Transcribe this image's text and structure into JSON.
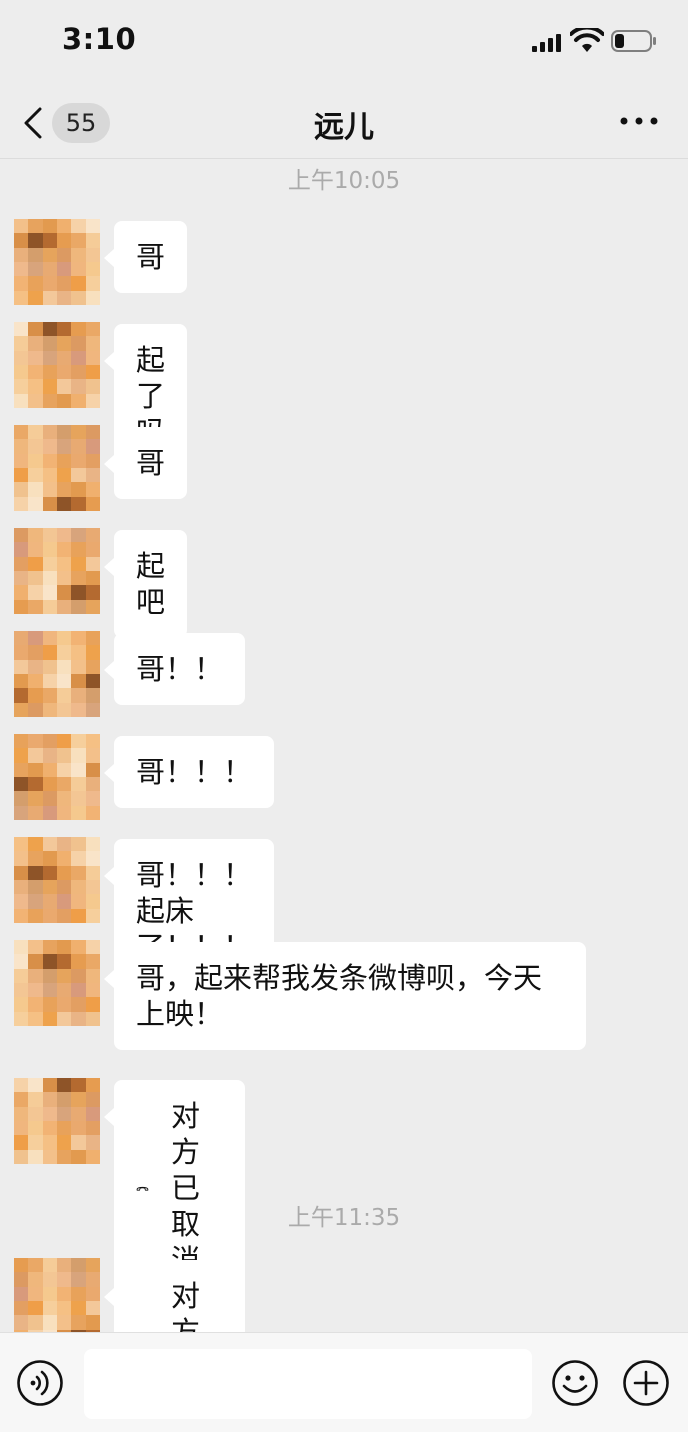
{
  "status_bar": {
    "time": "3:10"
  },
  "nav": {
    "unread_count": "55",
    "title": "远儿"
  },
  "chat": {
    "time_dividers": [
      "上午10:05",
      "上午11:35"
    ],
    "messages": [
      {
        "type": "text",
        "text": "哥"
      },
      {
        "type": "text",
        "text": "起了吗"
      },
      {
        "type": "text",
        "text": "哥"
      },
      {
        "type": "text",
        "text": "起吧"
      },
      {
        "type": "text",
        "text": "哥！！"
      },
      {
        "type": "text",
        "text": "哥！！！"
      },
      {
        "type": "text",
        "text": "哥！！！起床了！！！"
      },
      {
        "type": "text",
        "text": "哥，起来帮我发条微博呗，今天上映！"
      },
      {
        "type": "call",
        "text": "对方已取消"
      },
      {
        "type": "call",
        "text": "对方已取消"
      }
    ]
  },
  "avatar_colors": [
    "#f3c08a",
    "#e7a35e",
    "#e29a4f",
    "#f0b06e",
    "#f6d2a8",
    "#f9e4c9",
    "#d88f48",
    "#8e5428",
    "#b46a30",
    "#e69c50",
    "#eaa866",
    "#f5cc98",
    "#e9b07c",
    "#d49e6c",
    "#e6a45c",
    "#dc9a62",
    "#efb77c",
    "#f3c694",
    "#efb98c",
    "#d8a47c",
    "#e8aa72",
    "#d89a7c",
    "#f0b67e",
    "#f5c98e",
    "#f2b374",
    "#e8a25a",
    "#eaa96e",
    "#e39f62",
    "#ef9e48",
    "#f6cf9c",
    "#f5c084",
    "#eea24c",
    "#f3c89a",
    "#e9b486",
    "#f0c28e",
    "#f8e0be"
  ],
  "input": {
    "placeholder": ""
  }
}
